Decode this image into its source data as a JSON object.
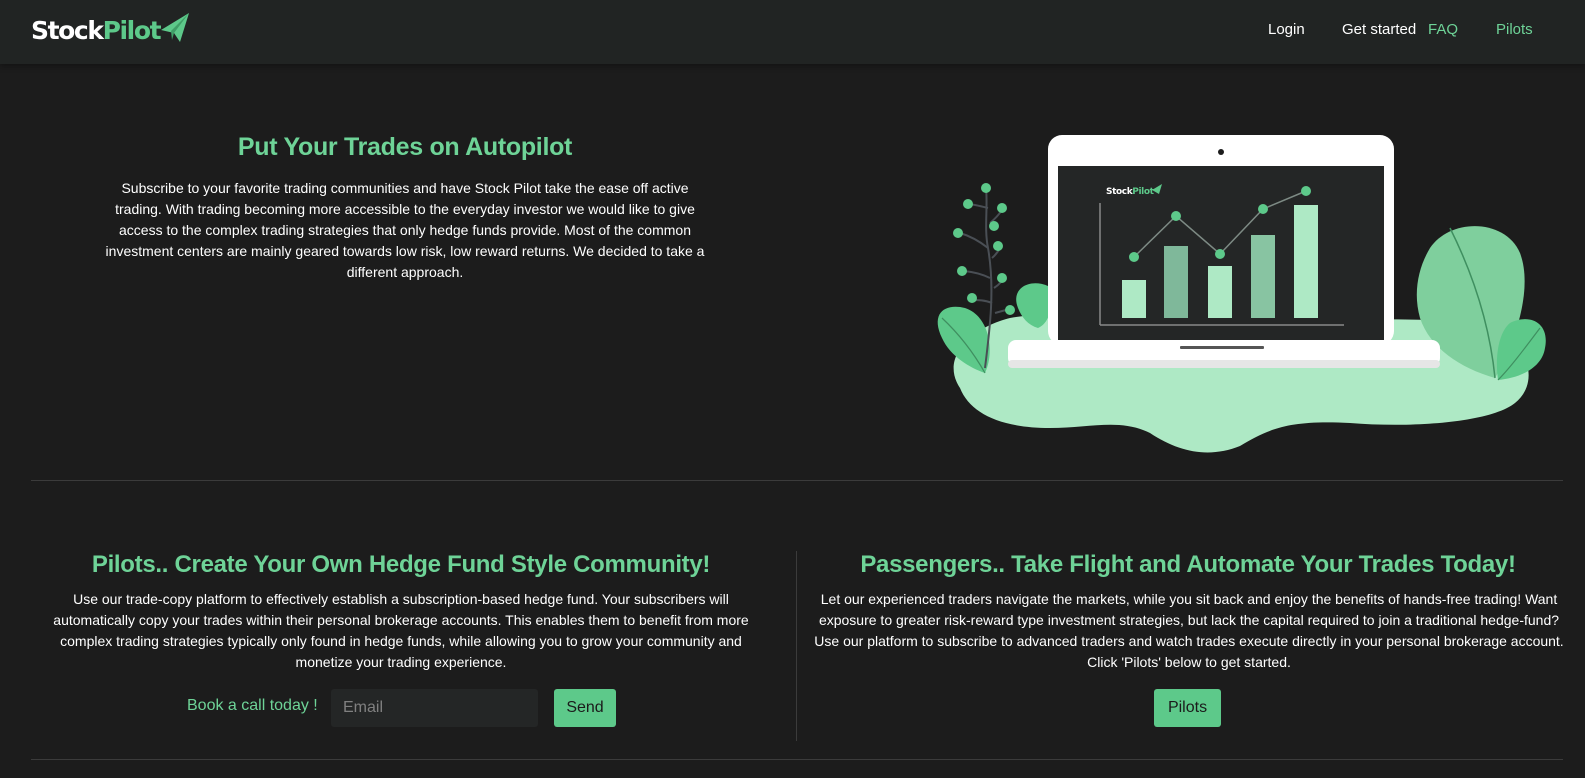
{
  "brand": {
    "logo_part1": "Stock",
    "logo_part2": "Pilot",
    "accent_color": "#6ed397",
    "button_color": "#5dc98a",
    "background_color": "#1c1c1c",
    "navbar_color": "#212423"
  },
  "nav": {
    "login": "Login",
    "get_started": "Get started",
    "faq": "FAQ",
    "pilots": "Pilots"
  },
  "hero": {
    "title": "Put Your Trades on Autopilot",
    "text": "Subscribe to your favorite trading communities and have Stock Pilot take the ease off active trading. With trading becoming more accessible to the everyday investor we would like to give access to the complex trading strategies that only hedge funds provide. Most of the common investment centers are mainly geared towards low risk, low reward returns. We decided to take a different approach.",
    "illustration": {
      "screen_logo_part1": "Stock",
      "screen_logo_part2": "Pilot",
      "icons": [
        "laptop-icon",
        "bar-chart-icon",
        "leaf-icon",
        "plant-icon"
      ]
    }
  },
  "pilots_section": {
    "title": "Pilots.. Create Your Own Hedge Fund Style Community!",
    "text": "Use our trade-copy platform to effectively establish a subscription-based hedge fund. Your subscribers will automatically copy your trades within their personal brokerage accounts. This enables them to benefit from more complex trading strategies typically only found in hedge funds, while allowing you to grow your community and monetize your trading experience.",
    "book_label": "Book a call today !",
    "email_placeholder": "Email",
    "email_value": "",
    "send_label": "Send"
  },
  "passengers_section": {
    "title": "Passengers.. Take Flight and Automate Your Trades Today!",
    "text": "Let our experienced traders navigate the markets, while you sit back and enjoy the benefits of hands-free trading! Want exposure to greater risk-reward type investment strategies, but lack the capital required to join a traditional hedge-fund? Use our platform to subscribe to advanced traders and watch trades execute directly in your personal brokerage account. Click 'Pilots' below to get started.",
    "pilots_button_label": "Pilots"
  }
}
